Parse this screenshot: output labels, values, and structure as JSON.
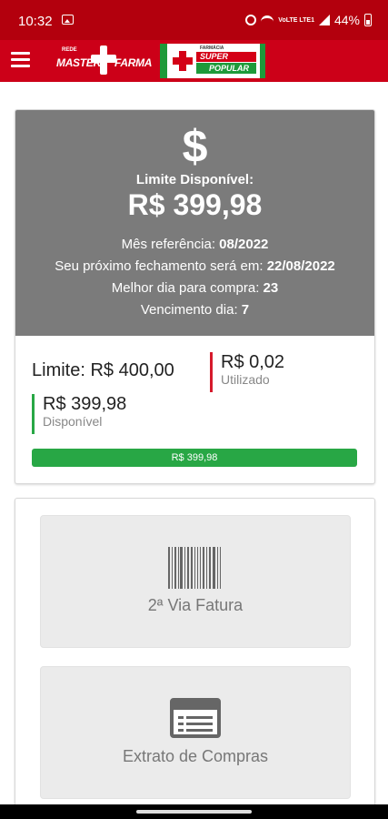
{
  "status_bar": {
    "time": "10:32",
    "battery": "44%",
    "network_label": "VoLTE LTE1"
  },
  "app_bar": {
    "logo_master": {
      "rede": "REDE",
      "master": "MASTER",
      "farma": "FARMA"
    },
    "logo_super": {
      "small": "FARMÁCIA",
      "super": "SUPER",
      "popular": "POPULAR"
    }
  },
  "limit_card": {
    "icon": "$",
    "label": "Limite Disponível:",
    "amount": "R$ 399,98",
    "lines": [
      {
        "text": "Mês referência: ",
        "value": "08/2022"
      },
      {
        "text": "Seu próximo fechamento será em: ",
        "value": "22/08/2022"
      },
      {
        "text": "Melhor dia para compra: ",
        "value": "23"
      },
      {
        "text": "Vencimento dia: ",
        "value": "7"
      }
    ],
    "limit_total": "Limite: R$ 400,00",
    "used_value": "R$ 0,02",
    "used_label": "Utilizado",
    "available_value": "R$ 399,98",
    "available_label": "Disponível",
    "progress_label": "R$ 399,98",
    "progress_fraction": 0.99995,
    "colors": {
      "used": "#d61a2c",
      "available": "#28a745",
      "header_bg": "#7b7b7b"
    }
  },
  "actions": {
    "segunda_via": {
      "label": "2ª Via Fatura",
      "icon": "barcode-icon"
    },
    "extrato": {
      "label": "Extrato de Compras",
      "icon": "list-icon"
    }
  },
  "theme": {
    "brand_red": "#cc0018",
    "status_red": "#b3000d"
  }
}
